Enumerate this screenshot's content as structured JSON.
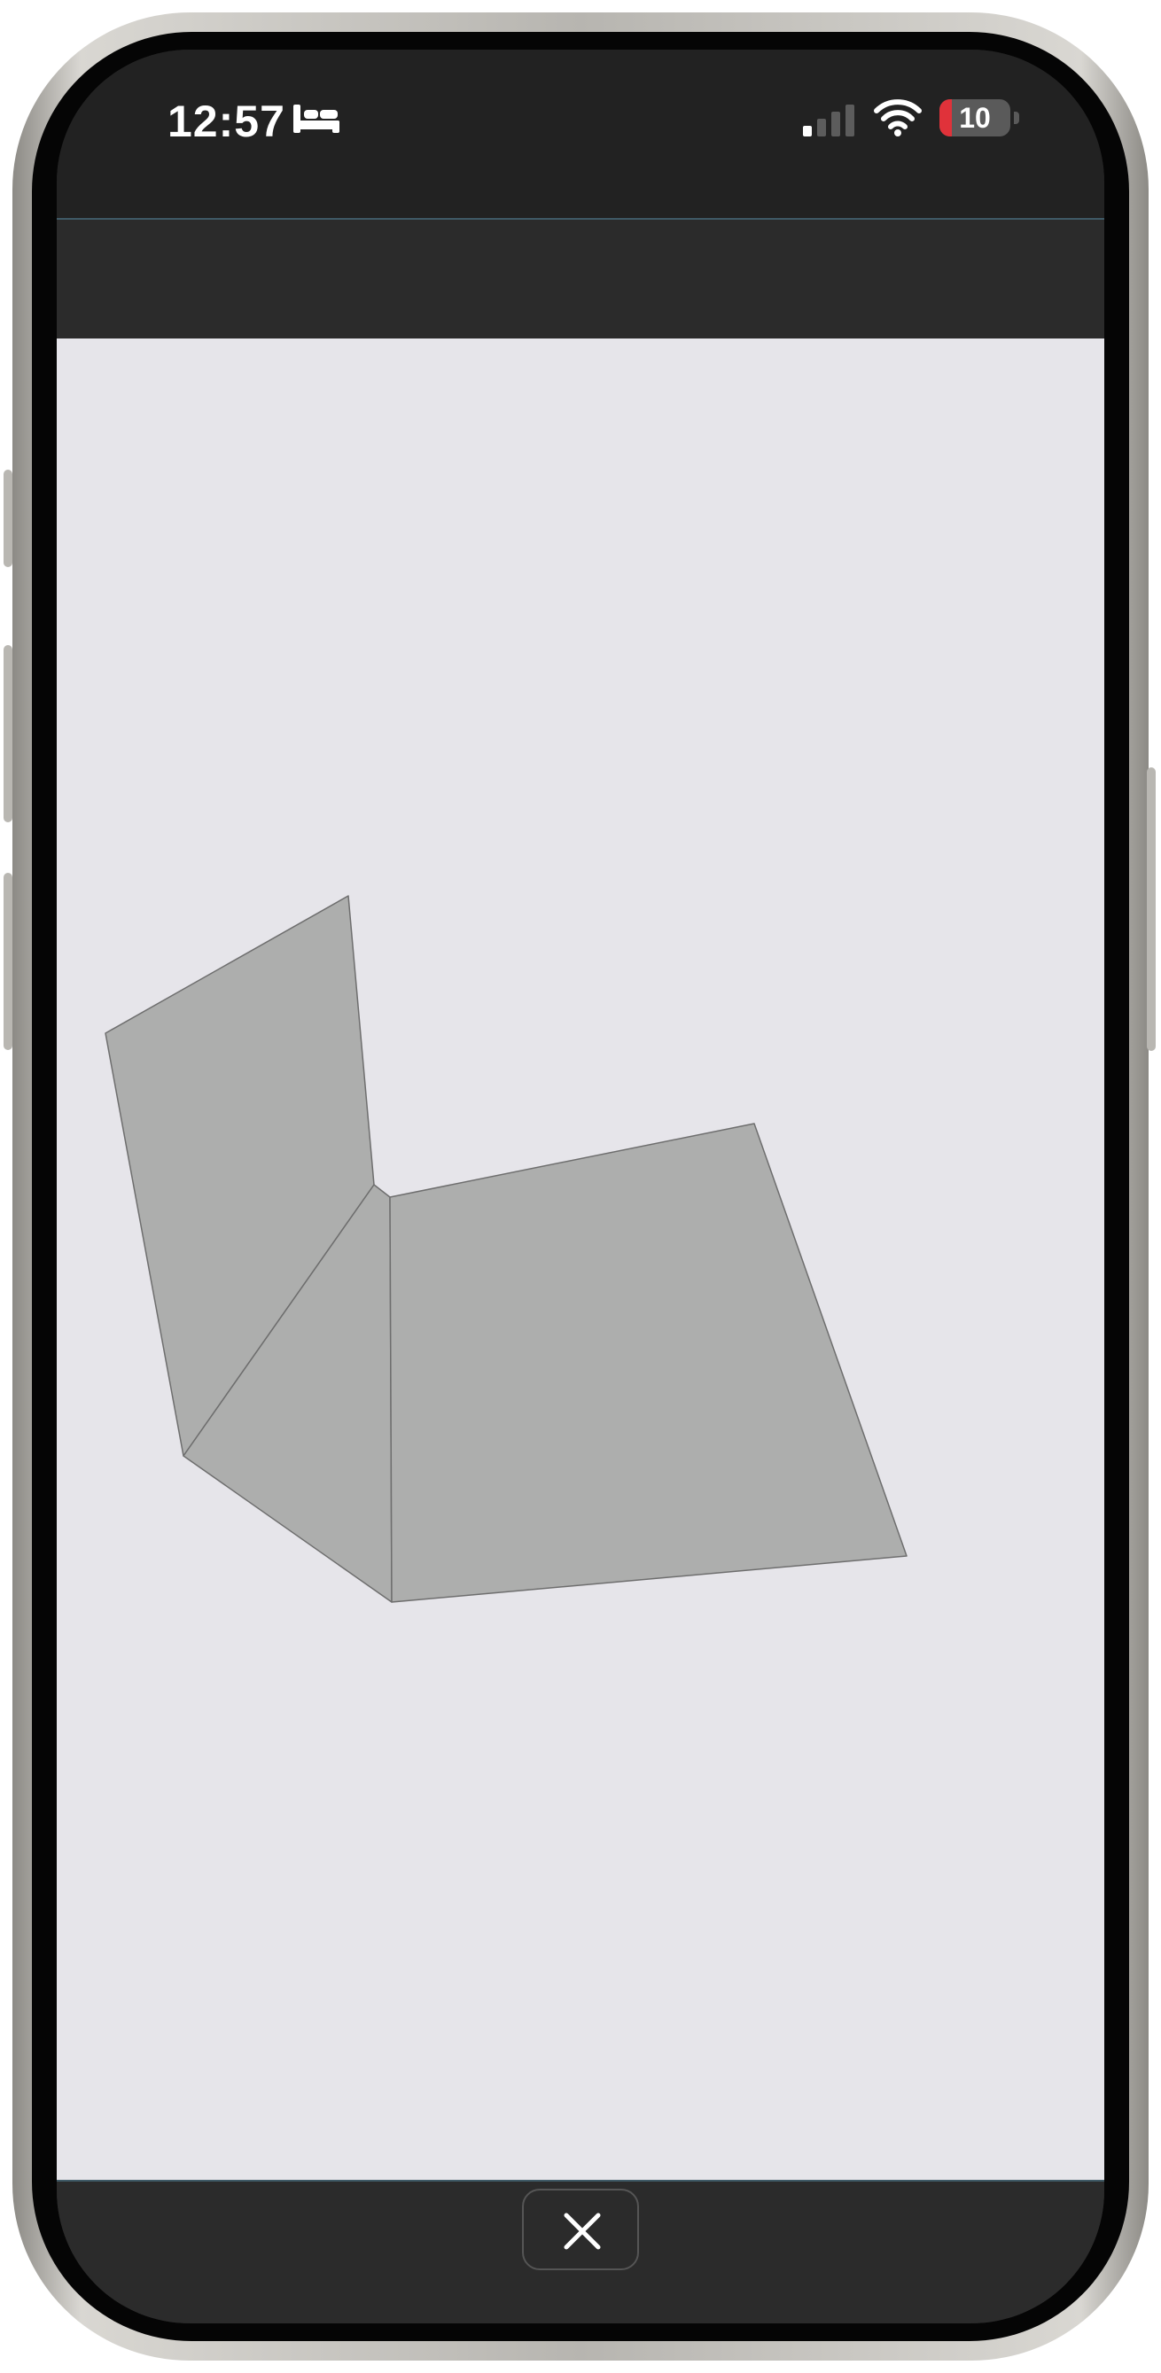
{
  "status_bar": {
    "time": "12:57",
    "sleep_icon": "bed-icon",
    "signal_icon": "cellular-signal-icon",
    "wifi_icon": "wifi-icon",
    "battery_level": "10",
    "battery_fraction": 0.1,
    "battery_color": "#e0323a"
  },
  "toolbar": {},
  "canvas": {
    "background": "#e6e5ea",
    "shape_fill": "#adaead",
    "shape_stroke": "#6e6e6e"
  },
  "bottom_bar": {
    "close_icon": "close-icon"
  }
}
